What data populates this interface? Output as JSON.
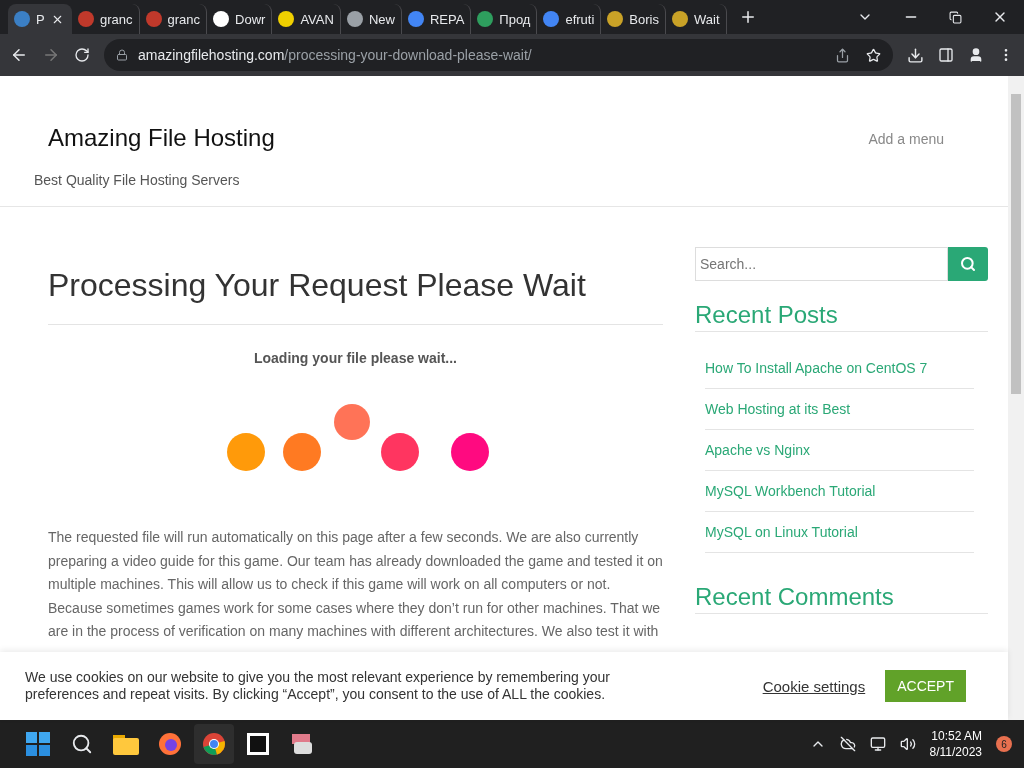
{
  "browser": {
    "tabs": [
      {
        "title": "P",
        "selected": true,
        "color": "#3b7fc4"
      },
      {
        "title": "granc",
        "selected": false,
        "color": "#c0392b"
      },
      {
        "title": "granc",
        "selected": false,
        "color": "#c0392b"
      },
      {
        "title": "Dowr",
        "selected": false,
        "color": "#ffffff"
      },
      {
        "title": "AVAN",
        "selected": false,
        "color": "#f0d000"
      },
      {
        "title": "New",
        "selected": false,
        "color": "#9aa0a6"
      },
      {
        "title": "REPA",
        "selected": false,
        "color": "#4285f4"
      },
      {
        "title": "Прод",
        "selected": false,
        "color": "#2e9e5e"
      },
      {
        "title": "efruti",
        "selected": false,
        "color": "#4285f4"
      },
      {
        "title": "Boris",
        "selected": false,
        "color": "#c9a227"
      },
      {
        "title": "Wait",
        "selected": false,
        "color": "#c9a227"
      }
    ],
    "url_domain": "amazingfilehosting.com",
    "url_path": "/processing-your-download-please-wait/"
  },
  "site": {
    "title": "Amazing File Hosting",
    "tagline": "Best Quality File Hosting Servers",
    "menu": "Add a menu"
  },
  "article": {
    "heading": "Processing Your Request Please Wait",
    "loading_text": "Loading your file please wait...",
    "paragraph": "The requested file will run automatically on this page after a few seconds. We are also currently preparing a video guide for this game. Our team has already downloaded the game and tested it on multiple machines. This will allow us to check if this game will work on all computers or not. Because sometimes games work for some cases where they don’t run for other machines. That we are in the process of verification on many machines with different architectures. We also test it with"
  },
  "sidebar": {
    "search": {
      "placeholder": "Search..."
    },
    "recent_posts_title": "Recent Posts",
    "recent_posts": [
      "How To Install Apache on CentOS 7",
      "Web Hosting at its Best",
      "Apache vs Nginx",
      "MySQL Workbench Tutorial",
      "MySQL on Linux Tutorial"
    ],
    "recent_comments_title": "Recent Comments"
  },
  "cookie_bar": {
    "text": "We use cookies on our website to give you the most relevant experience by remembering your preferences and repeat visits. By clicking “Accept”, you consent to the use of ALL the cookies.",
    "settings_link": "Cookie settings",
    "accept_button": "ACCEPT"
  },
  "taskbar": {
    "time": "10:52 AM",
    "date": "8/11/2023",
    "notifications": "6"
  }
}
